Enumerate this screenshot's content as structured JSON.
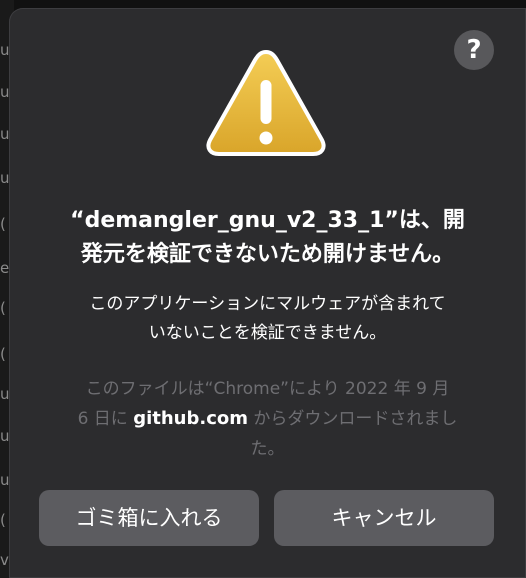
{
  "background_glyphs": [
    "u",
    "u",
    "u",
    "u",
    "(",
    "e",
    "(",
    "(",
    "u",
    "u",
    "u",
    "(",
    "v"
  ],
  "dialog": {
    "help_label": "?",
    "icon": "warning-triangle-icon",
    "title_line1": "“demangler_gnu_v2_33_1”は、開",
    "title_line2": "発元を検証できないため開けません。",
    "message_line1": "このアプリケーションにマルウェアが含まれて",
    "message_line2": "いないことを検証できません。",
    "info_line1": "このファイルは“Chrome”により 2022 年 9 月",
    "info_line2_prefix": "6 日に ",
    "info_link": "github.com",
    "info_line2_suffix": " からダウンロードされまし",
    "info_line3": "た。"
  },
  "buttons": {
    "move_to_trash": "ゴミ箱に入れる",
    "cancel": "キャンセル"
  },
  "colors": {
    "dialog_bg": "#2c2c2e",
    "button_bg": "#5c5c60",
    "icon_yellow": "#e7b83a",
    "help_bg": "#58585b"
  }
}
